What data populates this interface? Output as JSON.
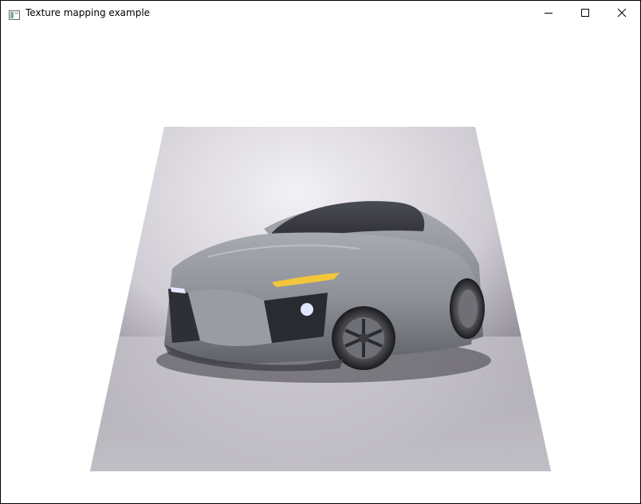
{
  "window": {
    "title": "Texture mapping example",
    "icon": "app-window-icon",
    "controls": {
      "minimize": "minimize-icon",
      "maximize": "maximize-icon",
      "close": "close-icon"
    }
  },
  "scene": {
    "content": "textured-quad-car-render",
    "colors": {
      "backdrop_light": "#f2f1f5",
      "backdrop_mid": "#cfcbd3",
      "backdrop_dark": "#6c6874",
      "car_body": "#8e9097",
      "car_dark": "#2b2c31",
      "headlight": "#f3c63a"
    }
  }
}
